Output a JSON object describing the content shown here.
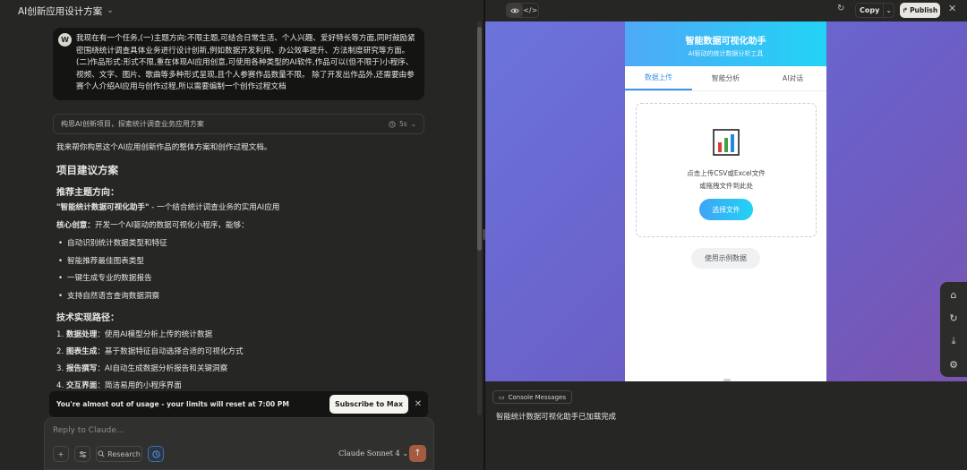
{
  "left": {
    "conversation_title": "AI创新应用设计方案",
    "user_initial": "W",
    "user_message": "我现在有一个任务,(一)主题方向:不限主题,可结合日常生活、个人兴趣、爱好特长等方面,同时鼓励紧密围绕统计调查具体业务进行设计创新,例如数据开发利用、办公效率提升、方法制度研究等方面。(二)作品形式:形式不限,重在体现AI应用创意,可使用各种类型的AI软件,作品可以(但不限于)小程序、视频、文字、图片、歌曲等多种形式呈现,且个人参赛作品数量不限。 除了开发出作品外,还需要由参赛个人介绍AI应用与创作过程,所以需要编制一个创作过程文档",
    "thinking_label": "构思AI创新项目，探索统计调查业务应用方案",
    "thinking_time": "5s",
    "response": {
      "intro": "我来帮你构思这个AI应用创新作品的整体方案和创作过程文档。",
      "h_project": "项目建议方案",
      "h_theme": "推荐主题方向：",
      "theme_bold": "\"智能统计数据可视化助手\"",
      "theme_rest": " - 一个结合统计调查业务的实用AI应用",
      "core_bold": "核心创意：",
      "core_rest": "开发一个AI驱动的数据可视化小程序，能够：",
      "bullets": [
        "自动识别统计数据类型和特征",
        "智能推荐最佳图表类型",
        "一键生成专业的数据报告",
        "支持自然语言查询数据洞察"
      ],
      "h_tech": "技术实现路径：",
      "steps": [
        {
          "num": "1.",
          "bold": "数据处理",
          "rest": "：使用AI模型分析上传的统计数据"
        },
        {
          "num": "2.",
          "bold": "图表生成",
          "rest": "：基于数据特征自动选择合适的可视化方式"
        },
        {
          "num": "3.",
          "bold": "报告撰写",
          "rest": "：AI自动生成数据分析报告和关键洞察"
        },
        {
          "num": "4.",
          "bold": "交互界面",
          "rest": "：简洁易用的小程序界面"
        }
      ]
    },
    "limit_notice": "You're almost out of usage - your limits will reset at 7:00 PM",
    "subscribe_label": "Subscribe to Max",
    "composer_placeholder": "Reply to Claude...",
    "research_label": "Research",
    "model_label": "Claude Sonnet 4"
  },
  "right": {
    "copy_label": "Copy",
    "publish_label": "Publish",
    "app": {
      "title": "智能数据可视化助手",
      "subtitle": "AI驱动的统计数据分析工具",
      "tabs": [
        "数据上传",
        "智能分析",
        "AI对话"
      ],
      "upload_line1": "点击上传CSV或Excel文件",
      "upload_line2": "或拖拽文件到此处",
      "choose_label": "选择文件",
      "sample_label": "使用示例数据"
    },
    "console_label": "Console Messages",
    "console_message": "智能统计数据可视化助手已加载完成"
  },
  "colors": {
    "accent_blue": "#3f94e9",
    "send_button": "#a55a42",
    "preview_bg": "#6a60c8"
  }
}
